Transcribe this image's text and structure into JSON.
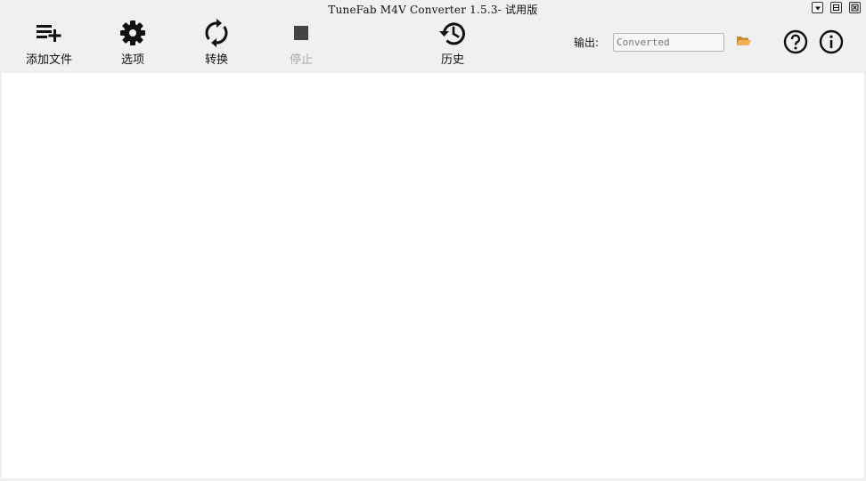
{
  "window": {
    "title": "TuneFab M4V Converter 1.5.3- 试用版"
  },
  "toolbar": {
    "add_files_label": "添加文件",
    "options_label": "选项",
    "convert_label": "转换",
    "stop_label": "停止",
    "history_label": "历史"
  },
  "output": {
    "label": "输出:",
    "placeholder": "Converted"
  },
  "icons": {
    "add_files": "playlist-add-icon",
    "options": "gear-icon",
    "convert": "refresh-icon",
    "stop": "stop-icon",
    "history": "history-icon",
    "folder": "folder-icon",
    "help": "help-icon",
    "info": "info-icon"
  },
  "colors": {
    "toolbar_bg": "#f0eff1",
    "content_bg": "#ffffff",
    "folder": "#e0a048",
    "disabled": "#a9a9a9"
  }
}
